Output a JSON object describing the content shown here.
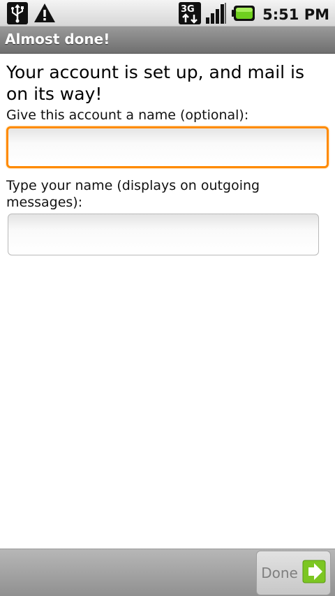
{
  "status_bar": {
    "icons": [
      "usb-icon",
      "warning-icon",
      "network-3g-icon",
      "signal-icon",
      "battery-icon"
    ],
    "network_label": "3G",
    "time": "5:51 PM"
  },
  "title_bar": {
    "title": "Almost done!"
  },
  "main": {
    "heading": "Your account is set up, and mail is on its way!",
    "account_name_label": "Give this account a name (optional):",
    "account_name_value": "",
    "your_name_label": "Type your name (displays on outgoing messages):",
    "your_name_value": ""
  },
  "bottom_bar": {
    "done_label": "Done"
  },
  "colors": {
    "focus_border": "#ff8a00",
    "done_icon": "#7cc622",
    "battery": "#6fcf1e"
  }
}
